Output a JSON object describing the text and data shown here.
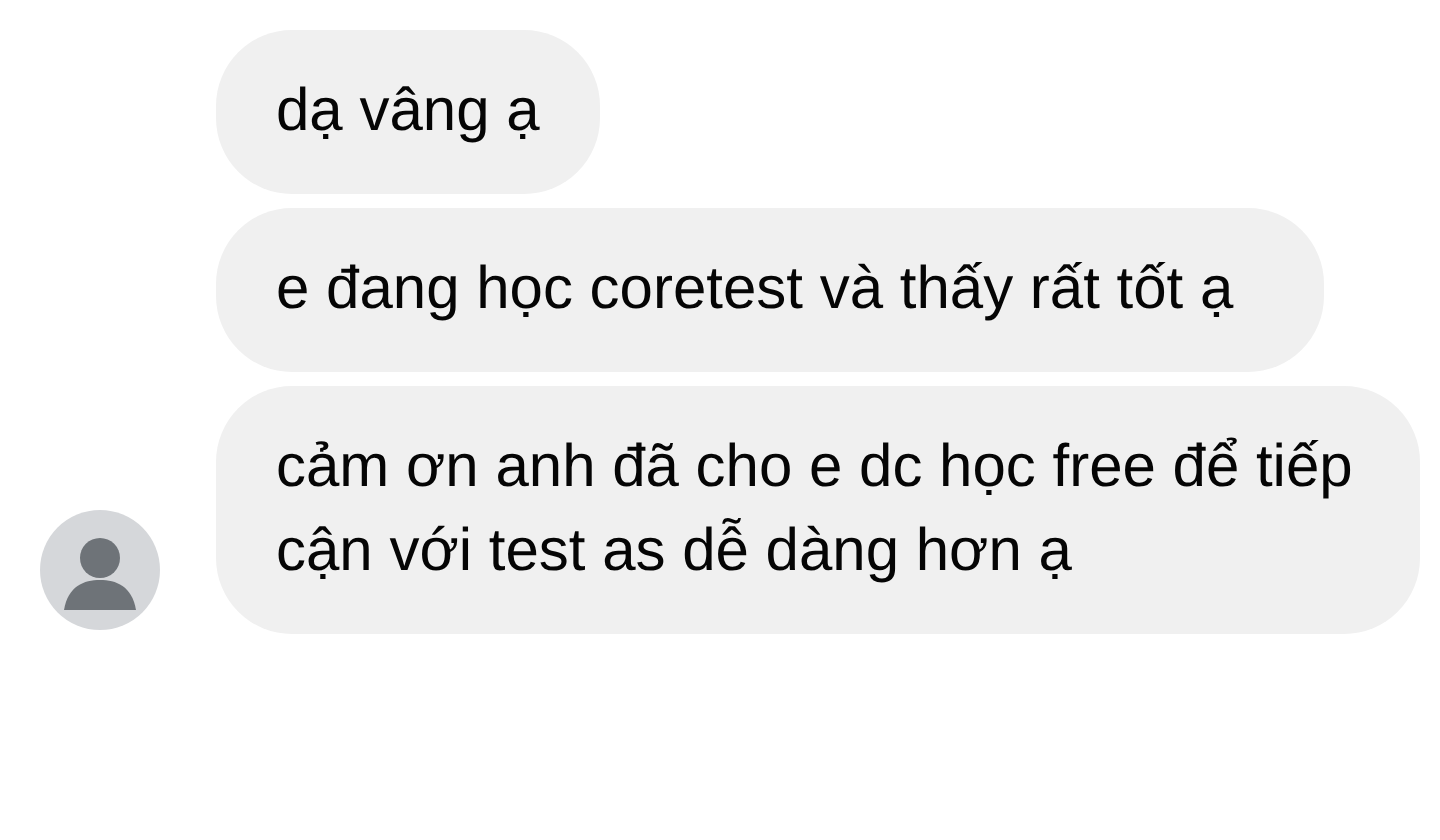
{
  "messages": [
    {
      "text": "dạ vâng ạ"
    },
    {
      "text": "e đang học coretest và thấy rất tốt ạ"
    },
    {
      "text": "cảm ơn anh đã cho e dc học free để tiếp cận với test as dễ dàng hơn ạ"
    }
  ]
}
